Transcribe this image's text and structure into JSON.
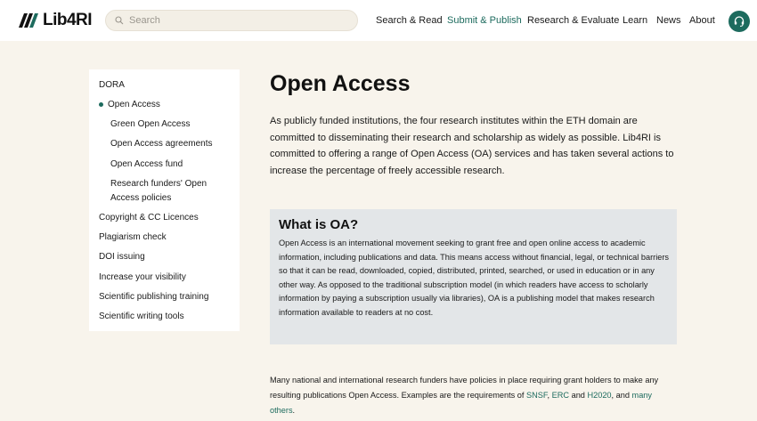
{
  "header": {
    "logo_text": "Lib4RI",
    "search_placeholder": "Search",
    "nav": [
      {
        "label": "Search & Read",
        "active": false
      },
      {
        "label": "Submit & Publish",
        "active": true
      },
      {
        "label": "Research & Evaluate",
        "active": false
      },
      {
        "label": "Learn",
        "active": false
      },
      {
        "label": "News",
        "active": false
      },
      {
        "label": "About",
        "active": false
      }
    ]
  },
  "sidebar": {
    "items": [
      {
        "label": "DORA"
      },
      {
        "label": "Open Access"
      },
      {
        "label": "Green Open Access"
      },
      {
        "label": "Open Access agreements"
      },
      {
        "label": "Open Access fund"
      },
      {
        "label": "Research funders' Open Access policies"
      },
      {
        "label": "Copyright & CC Licences"
      },
      {
        "label": "Plagiarism check"
      },
      {
        "label": "DOI issuing"
      },
      {
        "label": "Increase your visibility"
      },
      {
        "label": "Scientific publishing training"
      },
      {
        "label": "Scientific writing tools"
      }
    ]
  },
  "main": {
    "title": "Open Access",
    "intro": "As publicly funded institutions, the four research institutes within the ETH domain are committed to disseminating their research and scholarship as widely as possible. Lib4RI is committed to offering a range of Open Access (OA) services and has taken several actions to increase the percentage of freely accessible research.",
    "oa_box": {
      "title": "What is OA?",
      "text": "Open Access is an international movement seeking to grant free and open online access to academic information, including publications and data. This means access without financial, legal, or technical barriers so that it can be read, downloaded, copied, distributed, printed, searched, or used in education or in any other way. As opposed to the traditional subscription model (in which readers have access to scholarly information by paying a subscription usually via libraries), OA is a publishing model that makes research information available to readers at no cost."
    },
    "bottom": {
      "text_before": "Many national and international research funders have policies in place requiring grant holders to make any resulting publications Open Access. Examples are the requirements of ",
      "link_snsf": "SNSF",
      "sep1": ", ",
      "link_erc": "ERC",
      "sep2": " and ",
      "link_h2020": "H2020",
      "sep3": ", and ",
      "link_others": "many others",
      "end": "."
    }
  },
  "colors": {
    "accent": "#1d6b5e",
    "page_bg": "#f8f4ec",
    "box_bg": "#e3e6e8"
  }
}
